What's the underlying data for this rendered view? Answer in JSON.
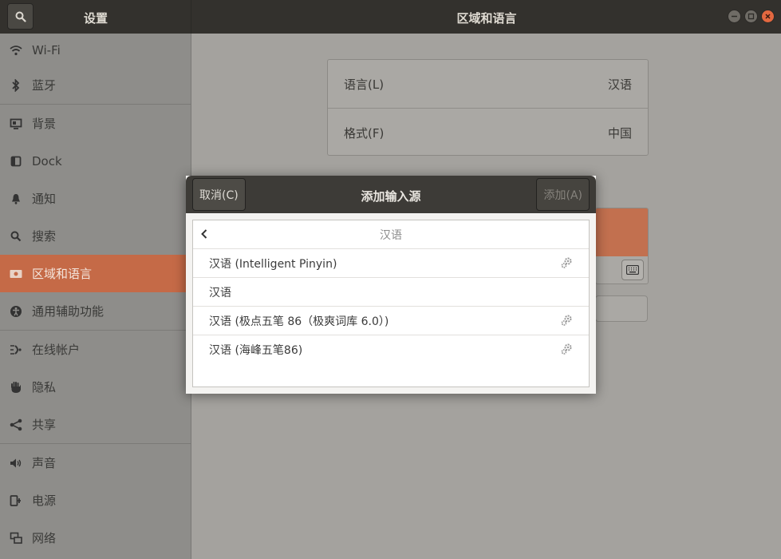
{
  "header": {
    "left_title": "设置",
    "title": "区域和语言"
  },
  "sidebar": {
    "items": [
      {
        "label": "Wi-Fi",
        "icon": "wifi-icon"
      },
      {
        "label": "蓝牙",
        "icon": "bluetooth-icon"
      },
      {
        "label": "背景",
        "icon": "background-icon"
      },
      {
        "label": "Dock",
        "icon": "dock-icon"
      },
      {
        "label": "通知",
        "icon": "bell-icon"
      },
      {
        "label": "搜索",
        "icon": "search-icon"
      },
      {
        "label": "区域和语言",
        "icon": "flag-icon",
        "active": true
      },
      {
        "label": "通用辅助功能",
        "icon": "accessibility-icon"
      },
      {
        "label": "在线帐户",
        "icon": "online-accounts-icon"
      },
      {
        "label": "隐私",
        "icon": "hand-icon"
      },
      {
        "label": "共享",
        "icon": "share-icon"
      },
      {
        "label": "声音",
        "icon": "speaker-icon"
      },
      {
        "label": "电源",
        "icon": "power-icon"
      },
      {
        "label": "网络",
        "icon": "network-icon"
      }
    ]
  },
  "region": {
    "language_label": "语言(L)",
    "language_value": "汉语",
    "formats_label": "格式(F)",
    "formats_value": "中国"
  },
  "dialog": {
    "cancel_label": "取消(C)",
    "title": "添加输入源",
    "add_label": "添加(A)",
    "list_header": "汉语",
    "items": [
      {
        "label": "汉语 (Intelligent Pinyin)",
        "has_settings": true
      },
      {
        "label": "汉语",
        "has_settings": false
      },
      {
        "label": "汉语 (极点五笔 86（极爽词库 6.0）)",
        "has_settings": true
      },
      {
        "label": "汉语 (海峰五笔86)",
        "has_settings": true
      }
    ]
  },
  "colors": {
    "accent": "#c56a47",
    "header": "#33312d",
    "close_button": "#e36840"
  }
}
